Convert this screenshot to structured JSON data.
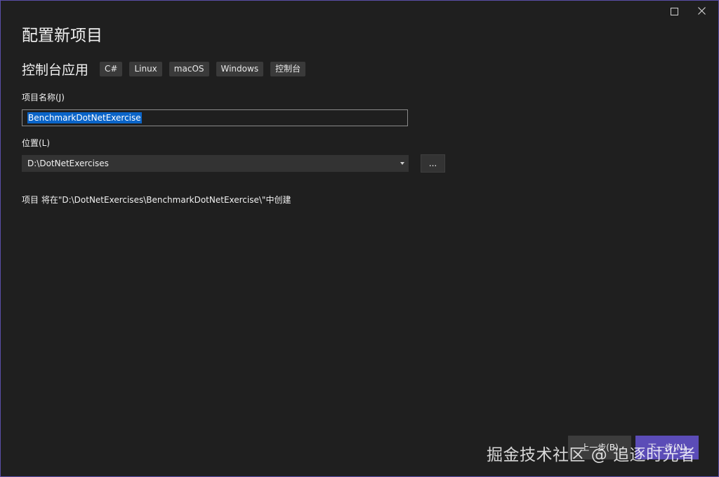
{
  "dialog": {
    "title": "配置新项目",
    "template_name": "控制台应用",
    "tags": [
      "C#",
      "Linux",
      "macOS",
      "Windows",
      "控制台"
    ]
  },
  "fields": {
    "project_name_label": "项目名称(J)",
    "project_name_value": "BenchmarkDotNetExercise",
    "location_label": "位置(L)",
    "location_value": "D:\\DotNetExercises",
    "browse_label": "..."
  },
  "info": {
    "path_message": "项目 将在\"D:\\DotNetExercises\\BenchmarkDotNetExercise\\\"中创建"
  },
  "footer": {
    "back_label": "上一步(B)",
    "next_label": "下一步(N)"
  },
  "watermark": {
    "text": "掘金技术社区 @ 追逐时光者"
  },
  "colors": {
    "accent": "#5b4cb7",
    "selection": "#0a64c8",
    "background": "#1f1f1f"
  },
  "icons": {
    "maximize": "maximize-icon",
    "close": "close-icon",
    "dropdown": "chevron-down-icon"
  }
}
